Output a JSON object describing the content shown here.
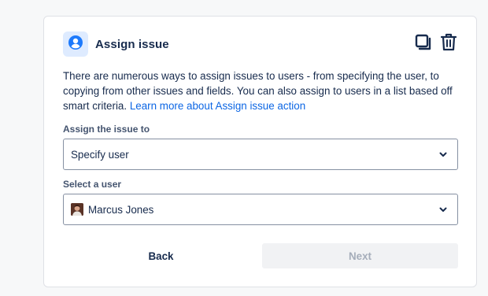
{
  "card": {
    "title": "Assign issue",
    "action_icon": "user-circle-icon",
    "copy_icon": "copy-icon",
    "delete_icon": "trash-icon"
  },
  "description": {
    "text": "There are numerous ways to assign issues to users - from specifying the user, to copying from other issues and fields. You can also assign to users in a list based off smart criteria.",
    "link": "Learn more about Assign issue action"
  },
  "assign_field": {
    "label": "Assign the issue to",
    "value": "Specify user"
  },
  "user_field": {
    "label": "Select a user",
    "value": "Marcus Jones",
    "avatar_icon": "user-avatar"
  },
  "buttons": {
    "back": "Back",
    "next": "Next"
  },
  "colors": {
    "accent": "#0c66e4",
    "icon_bg": "#deebff",
    "text": "#172b4d",
    "disabled_text": "#a5adba",
    "disabled_bg": "#f1f2f4"
  }
}
